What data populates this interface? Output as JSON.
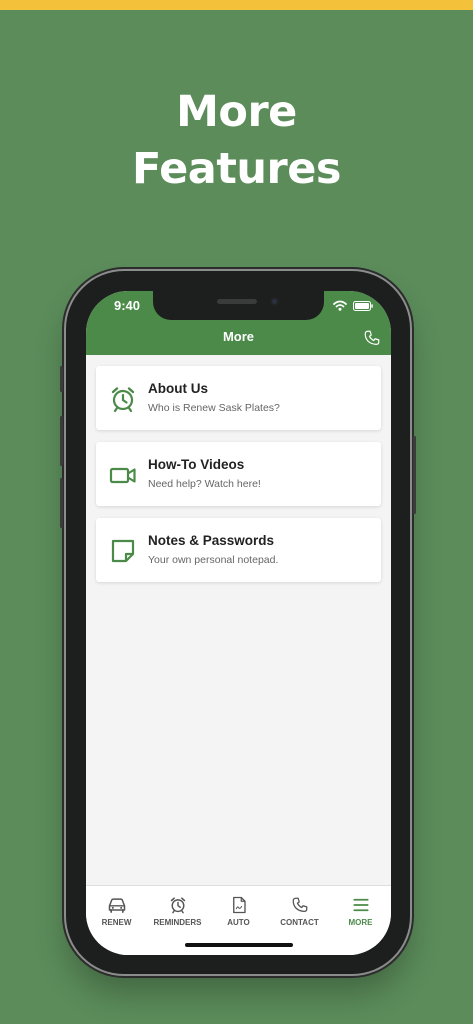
{
  "promo": {
    "headline_line1": "More",
    "headline_line2": "Features"
  },
  "status_bar": {
    "time": "9:40"
  },
  "header": {
    "title": "More"
  },
  "menu": [
    {
      "title": "About Us",
      "subtitle": "Who is Renew Sask Plates?",
      "icon": "alarm-clock-icon"
    },
    {
      "title": "How-To Videos",
      "subtitle": "Need help? Watch here!",
      "icon": "video-camera-icon"
    },
    {
      "title": "Notes & Passwords",
      "subtitle": "Your own personal notepad.",
      "icon": "note-icon"
    }
  ],
  "tabs": [
    {
      "label": "RENEW",
      "icon": "car-icon"
    },
    {
      "label": "REMINDERS",
      "icon": "alarm-clock-icon"
    },
    {
      "label": "AUTO",
      "icon": "document-icon"
    },
    {
      "label": "CONTACT",
      "icon": "phone-icon"
    },
    {
      "label": "MORE",
      "icon": "menu-icon",
      "active": true
    }
  ],
  "colors": {
    "brand_green": "#4b8a48",
    "background": "#5b8c5a",
    "accent_yellow": "#f3c13a"
  }
}
